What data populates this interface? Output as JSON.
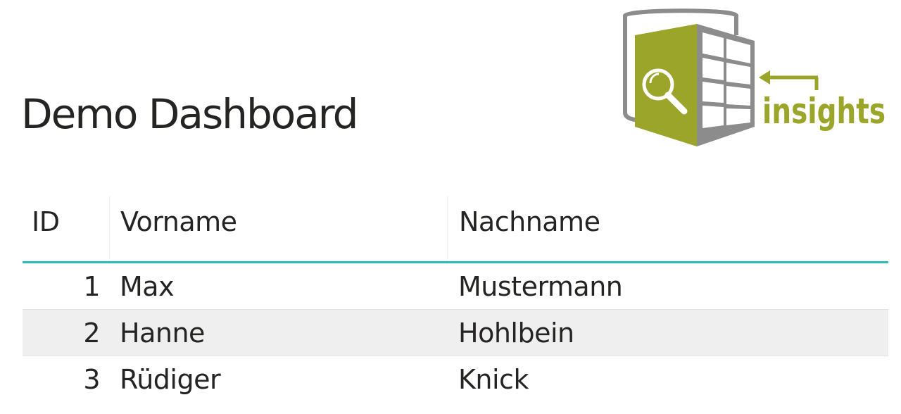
{
  "dashboard": {
    "title": "Demo Dashboard"
  },
  "logo": {
    "text": "insights",
    "colors": {
      "green": "#9aa52a",
      "gray": "#8c8c8c"
    }
  },
  "table": {
    "columns": [
      "ID",
      "Vorname",
      "Nachname"
    ],
    "rows": [
      {
        "id": "1",
        "vorname": "Max",
        "nachname": "Mustermann"
      },
      {
        "id": "2",
        "vorname": "Hanne",
        "nachname": "Hohlbein"
      },
      {
        "id": "3",
        "vorname": "Rüdiger",
        "nachname": "Knick"
      }
    ],
    "accent_color": "#2cbdb5"
  }
}
